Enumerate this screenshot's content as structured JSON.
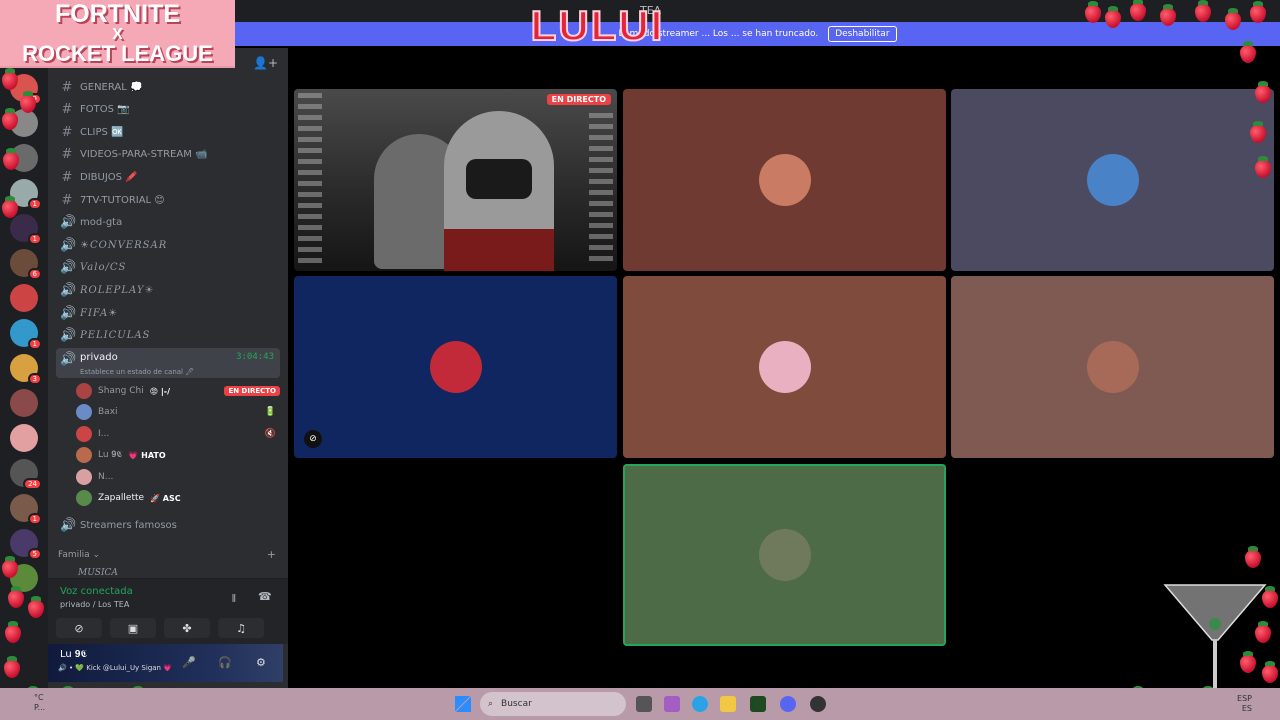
{
  "window": {
    "title": "TEA"
  },
  "banner": {
    "message": "El modo streamer ... Los ... se han truncado.",
    "button": "Deshabilitar"
  },
  "overlay": {
    "logo_line1": "FORTNITE",
    "logo_line2": "X",
    "logo_line3": "ROCKET LEAGUE",
    "name_art": "LULUI"
  },
  "servers": [
    {
      "badge": "29",
      "color": "#d9534f"
    },
    {
      "badge": "",
      "color": "#888"
    },
    {
      "badge": "",
      "color": "#6a6a6a"
    },
    {
      "badge": "1",
      "color": "#9aa"
    },
    {
      "badge": "1",
      "color": "#3a2b4a"
    },
    {
      "badge": "6",
      "color": "#6b4b3a"
    },
    {
      "badge": "",
      "color": "#c44"
    },
    {
      "badge": "1",
      "color": "#39c"
    },
    {
      "badge": "3",
      "color": "#d8a040"
    },
    {
      "badge": "",
      "color": "#8a4a4a"
    },
    {
      "badge": "",
      "color": "#e3a0a0"
    },
    {
      "badge": "24",
      "color": "#555"
    },
    {
      "badge": "1",
      "color": "#7a5a4a"
    },
    {
      "badge": "5",
      "color": "#4a3a6a"
    },
    {
      "badge": "",
      "color": "#5a8a3a"
    }
  ],
  "channels": [
    {
      "name": "GENERAL 💭",
      "icon": "#",
      "fancy": false
    },
    {
      "name": "FOTOS 📷",
      "icon": "#",
      "fancy": false
    },
    {
      "name": "CLIPS 🆗",
      "icon": "#",
      "fancy": false
    },
    {
      "name": "VIDEOS-PARA-STREAM 📹",
      "icon": "#",
      "fancy": false
    },
    {
      "name": "DIBUJOS 🖍️",
      "icon": "#",
      "fancy": false
    },
    {
      "name": "7TV-TUTORIAL 😊",
      "icon": "#",
      "fancy": false
    },
    {
      "name": "mod-gta",
      "icon": "🔊",
      "fancy": false
    },
    {
      "name": "☀CONVERSAR",
      "icon": "🔊",
      "fancy": true
    },
    {
      "name": "Valo/CS",
      "icon": "🔊",
      "fancy": true
    },
    {
      "name": "ROLEPLAY☀",
      "icon": "🔊",
      "fancy": true
    },
    {
      "name": "FIFA☀",
      "icon": "🔊",
      "fancy": true
    },
    {
      "name": "PELICULAS",
      "icon": "🔊",
      "fancy": true
    }
  ],
  "active_channel": {
    "name": "privado",
    "timer": "3:04:43",
    "status": "Establece un estado de canal 🖊"
  },
  "voice_users": [
    {
      "name": "Shang Chi",
      "extra": "😡 |-/",
      "live": "EN DIRECTO",
      "icon": "",
      "color": "#a44"
    },
    {
      "name": "Baxi",
      "extra": "",
      "live": "",
      "icon": "🔋",
      "color": "#6a8ac8"
    },
    {
      "name": "I...",
      "extra": "",
      "live": "",
      "icon": "🔇",
      "color": "#c44"
    },
    {
      "name": "Lu 𝟗𝕮",
      "extra": "💗 HATO",
      "live": "",
      "icon": "",
      "color": "#b86a4a"
    },
    {
      "name": "N...",
      "extra": "",
      "live": "",
      "icon": "",
      "color": "#d8a0a0"
    },
    {
      "name": "Zapallette",
      "extra": "🚀 ASC",
      "live": "",
      "icon": "",
      "color": "#5a8a4a"
    }
  ],
  "extra_channel": {
    "name": "Streamers famosos"
  },
  "category": {
    "name": "Familia ⌄",
    "next": "MUSICA"
  },
  "voice_panel": {
    "title": "Voz conectada",
    "subtitle": "privado / Los TEA"
  },
  "user_panel": {
    "name": "Lu 𝟗𝕮",
    "status": "🔊 • 💚 Kick @Lului_Uy Sigan 💗"
  },
  "tiles": [
    {
      "kind": "stream",
      "live": "EN DIRECTO",
      "bg": "#2b2b2b",
      "avatar": ""
    },
    {
      "kind": "avatar",
      "live": "",
      "bg": "#6e3a32",
      "avatar": "#c97b64"
    },
    {
      "kind": "avatar",
      "live": "",
      "bg": "#4b4a61",
      "avatar": "#4a82c8"
    },
    {
      "kind": "avatar",
      "live": "",
      "bg": "#0f2660",
      "avatar": "#c22a3a"
    },
    {
      "kind": "avatar",
      "live": "",
      "bg": "#7e4b3c",
      "avatar": "#e8b0c0"
    },
    {
      "kind": "avatar",
      "live": "",
      "bg": "#7e5a52",
      "avatar": "#a86a58"
    },
    {
      "kind": "avatar",
      "live": "",
      "bg": "#4c6b46",
      "avatar": "#6f7a5c"
    }
  ],
  "taskbar": {
    "search": "Buscar",
    "weather_top": "°C",
    "weather_bottom": "P...",
    "lang_top": "ESP",
    "lang_bottom": "ES"
  }
}
